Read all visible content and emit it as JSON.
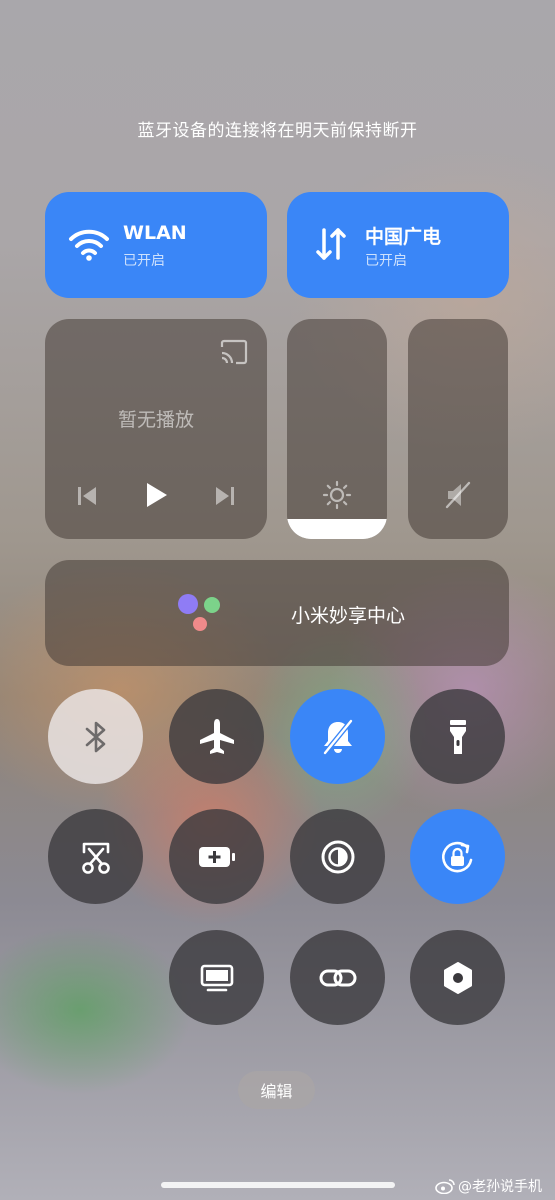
{
  "notice": "蓝牙设备的连接将在明天前保持断开",
  "wlan": {
    "title": "WLAN",
    "status": "已开启",
    "icon": "wifi-icon"
  },
  "mobile_data": {
    "title": "中国广电",
    "status": "已开启",
    "icon": "data-arrows-icon"
  },
  "media": {
    "empty_label": "暂无播放",
    "cast_icon": "cast-icon",
    "prev_icon": "previous-icon",
    "play_icon": "play-icon",
    "next_icon": "next-icon"
  },
  "brightness": {
    "icon": "brightness-icon",
    "level": 0.09
  },
  "volume": {
    "icon": "mute-icon",
    "level": 0.0
  },
  "share_center": {
    "label": "小米妙享中心"
  },
  "toggles": [
    {
      "name": "bluetooth",
      "icon": "bluetooth-icon",
      "state": "off"
    },
    {
      "name": "airplane",
      "icon": "airplane-icon",
      "state": "off"
    },
    {
      "name": "silent",
      "icon": "bell-mute-icon",
      "state": "on"
    },
    {
      "name": "flashlight",
      "icon": "flashlight-icon",
      "state": "off"
    },
    {
      "name": "screenshot",
      "icon": "scissors-icon",
      "state": "off"
    },
    {
      "name": "battery-saver",
      "icon": "battery-plus-icon",
      "state": "off"
    },
    {
      "name": "dark-mode",
      "icon": "contrast-icon",
      "state": "off"
    },
    {
      "name": "rotation-lock",
      "icon": "rotation-lock-icon",
      "state": "on"
    },
    {
      "name": "screen-cast",
      "icon": "monitor-icon",
      "state": "off"
    },
    {
      "name": "link",
      "icon": "link-icon",
      "state": "off"
    },
    {
      "name": "settings",
      "icon": "hexagon-settings-icon",
      "state": "off"
    }
  ],
  "edit_label": "编辑",
  "watermark": "@老孙说手机",
  "colors": {
    "accent": "#3a86f7"
  }
}
